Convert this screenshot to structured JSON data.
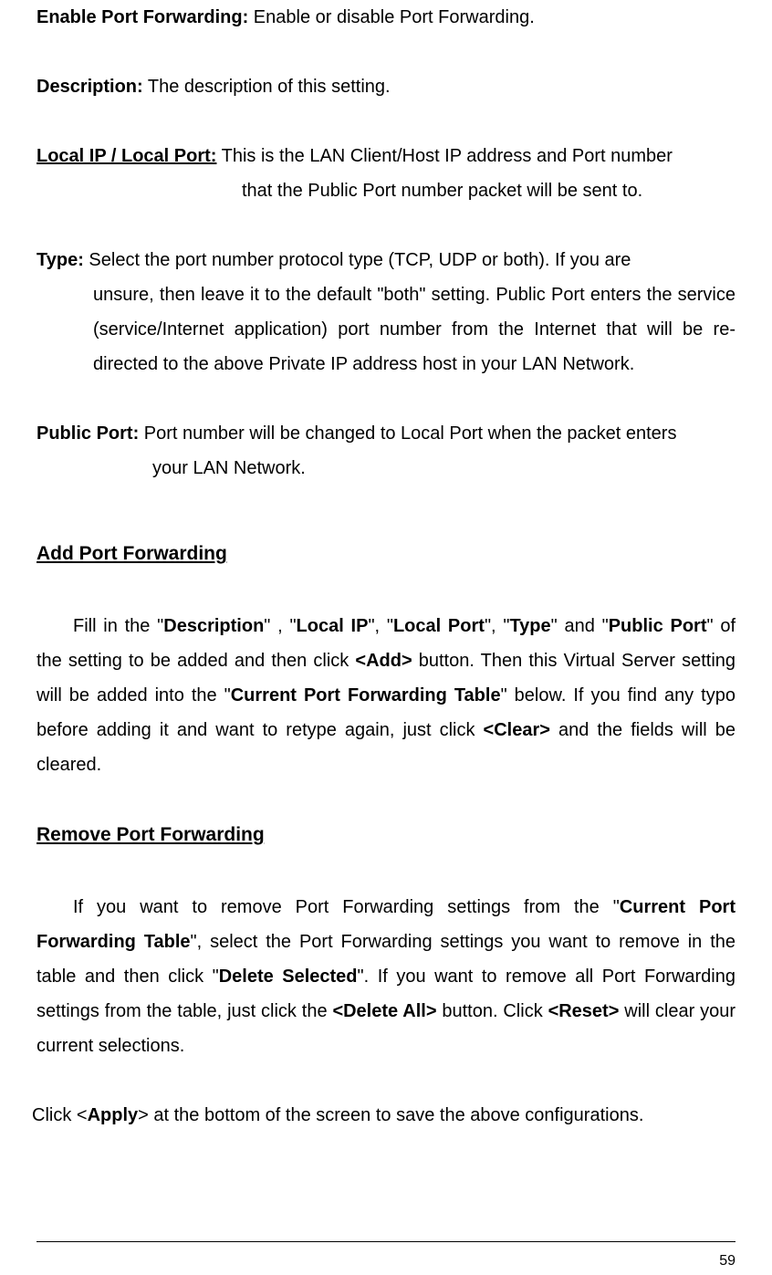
{
  "defs": {
    "enablePF": {
      "label": "Enable Port Forwarding:",
      "text": " Enable or disable Port Forwarding."
    },
    "description": {
      "label": "Description:",
      "text": " The description of this setting."
    },
    "localIPPort": {
      "label": "Local IP / Local Port:",
      "line1": " This is the LAN Client/Host IP address and Port number",
      "line2": "that the Public Port number packet will be sent to."
    },
    "type": {
      "label": "Type:",
      "line1": " Select the port number protocol type (TCP, UDP or both). If you are",
      "rest": "unsure, then leave it to the default \"both\" setting. Public Port enters the service (service/Internet application) port number from the Internet that will be re-directed to the above Private IP address host in your LAN Network."
    },
    "publicPort": {
      "label": "Public Port:",
      "line1": " Port number will be changed to Local Port when the packet enters",
      "line2": "your LAN Network."
    }
  },
  "sections": {
    "add": {
      "heading": "Add Port Forwarding",
      "para": {
        "t1": "Fill in the \"",
        "b1": "Description",
        "t2": "\" , \"",
        "b2": "Local IP",
        "t3": "\", \"",
        "b3": "Local Port",
        "t4": "\", \"",
        "b4": "Type",
        "t5": "\" and \"",
        "b5": "Public Port",
        "t6": "\" of the setting to be added and then click ",
        "b6": "<Add>",
        "t7": " button. Then this Virtual Server setting will be added into the \"",
        "b7": "Current Port Forwarding Table",
        "t8": "\" below. If you find any typo before adding it and want to retype again, just click ",
        "b8": "<Clear>",
        "t9": " and the fields will be cleared."
      }
    },
    "remove": {
      "heading": "Remove Port Forwarding",
      "para": {
        "t1": "If you want to remove Port Forwarding settings from the \"",
        "b1": "Current Port Forwarding Table",
        "t2": "\", select the Port Forwarding settings you want to remove in the table and then click \"",
        "b2": "Delete Selected",
        "t3": "\". If you want to remove all Port Forwarding settings from the table, just click the ",
        "b3": "<Delete All>",
        "t4": " button. Click ",
        "b4": "<Reset>",
        "t5": " will clear your current selections."
      }
    },
    "apply": {
      "t1": "Click <",
      "b1": "Apply",
      "t2": "> at the bottom of the screen to save the above configurations."
    }
  },
  "pageNumber": "59"
}
